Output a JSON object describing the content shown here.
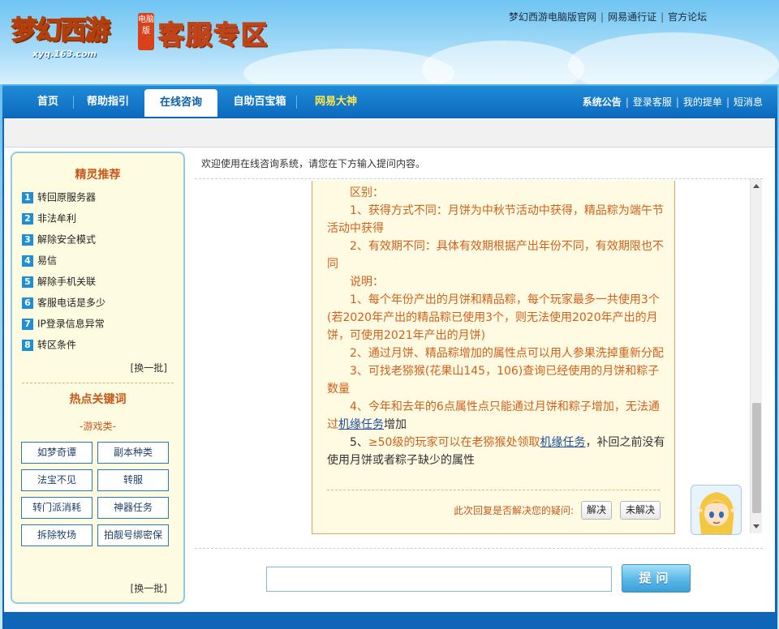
{
  "header": {
    "logo_title": "梦幻西游",
    "logo_tag": "电脑版",
    "logo_url": "xyq.163.com",
    "site_title": "客服专区",
    "top_links": [
      "梦幻西游电脑版官网",
      "网易通行证",
      "官方论坛"
    ]
  },
  "nav": {
    "items": [
      "首页",
      "帮助指引",
      "在线咨询",
      "自助百宝箱",
      "网易大神"
    ],
    "active": "在线咨询",
    "right_links": [
      "系统公告",
      "登录客服",
      "我的提单",
      "短消息"
    ]
  },
  "sidebar": {
    "recommend_title": "精灵推荐",
    "recommend_items": [
      {
        "num": "1",
        "text": "转回原服务器"
      },
      {
        "num": "2",
        "text": "非法牟利"
      },
      {
        "num": "3",
        "text": "解除安全模式"
      },
      {
        "num": "4",
        "text": "易信"
      },
      {
        "num": "5",
        "text": "解除手机关联"
      },
      {
        "num": "6",
        "text": "客服电话是多少"
      },
      {
        "num": "7",
        "text": "IP登录信息异常"
      },
      {
        "num": "8",
        "text": "转区条件"
      }
    ],
    "swap_label": "[换一批]",
    "hot_title": "热点关键词",
    "category": "-游戏类-",
    "keywords": [
      "如梦奇谭",
      "副本种类",
      "法宝不见",
      "转服",
      "转门派消耗",
      "神器任务",
      "拆除牧场",
      "拍靓号绑密保"
    ],
    "swap_label_2": "[换一批]"
  },
  "chat": {
    "welcome": "欢迎使用在线咨询系统，请您在下方输入提问内容。",
    "lines": {
      "l0": "区别：",
      "l1": "1、获得方式不同：月饼为中秋节活动中获得，精品粽为端午节活动中获得",
      "l2": "2、有效期不同：具体有效期根据产出年份不同，有效期限也不同",
      "l3": "说明：",
      "l4": "1、每个年份产出的月饼和精品粽，每个玩家最多一共使用3个(若2020年产出的精品粽已使用3个，则无法使用2020年产出的月饼，可使用2021年产出的月饼)",
      "l5": "2、通过月饼、精品粽增加的属性点可以用人参果洗掉重新分配",
      "l6": "3、可找老猕猴(花果山145，106)查询已经使用的月饼和粽子数量",
      "l7_a": "4、今年和去年的6点属性点只能通过月饼和粽子增加，无法通过",
      "l7_link": "机缘任务",
      "l7_b": "增加",
      "l8_a": "5、",
      "l8_b": "≥50级的玩家可以在老猕猴处领取",
      "l8_link": "机缘任务",
      "l8_c": "，补回之前没有使用月饼或者粽子缺少的属性"
    },
    "resolve_question": "此次回复是否解决您的疑问:",
    "resolved_label": "解决",
    "unresolved_label": "未解决"
  },
  "ask": {
    "input_value": "",
    "input_placeholder": "",
    "button_label": "提问"
  },
  "colors": {
    "nav_blue": "#0d6bbf",
    "accent_orange": "#d2601a",
    "sidebar_bg": "#fdfbe0",
    "link_blue": "#1b4f9b"
  }
}
